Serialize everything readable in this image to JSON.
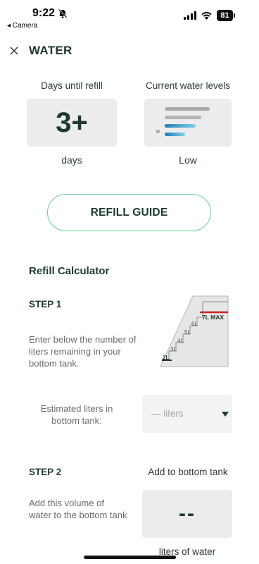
{
  "status_bar": {
    "time": "9:22",
    "back_app": "◂ Camera",
    "battery": "81"
  },
  "header": {
    "title": "WATER"
  },
  "refill_card": {
    "label": "Days until refill",
    "value": "3+",
    "unit": "days"
  },
  "levels_card": {
    "label": "Current water levels",
    "marker": "R",
    "status": "Low"
  },
  "refill_guide_button": "REFILL GUIDE",
  "calculator": {
    "title": "Refill Calculator",
    "step1": {
      "title": "STEP 1",
      "text": "Enter below the number of liters remaining in your bottom tank.",
      "tank_labels": [
        "2L",
        "3L",
        "4L",
        "5L",
        "6L",
        "7L MAX"
      ],
      "input_label": "Estimated liters in bottom tank:",
      "dropdown_value": "— liters"
    },
    "step2": {
      "title": "STEP 2",
      "right_label": "Add to bottom tank",
      "text": "Add this volume of water to the bottom tank",
      "result_value": "--",
      "result_unit": "liters of water"
    }
  },
  "colors": {
    "primary_text": "#1f3a2c",
    "accent_green": "#5fcf9c",
    "max_line": "#cc2b2b",
    "water_blue": "#1a7fb8"
  }
}
